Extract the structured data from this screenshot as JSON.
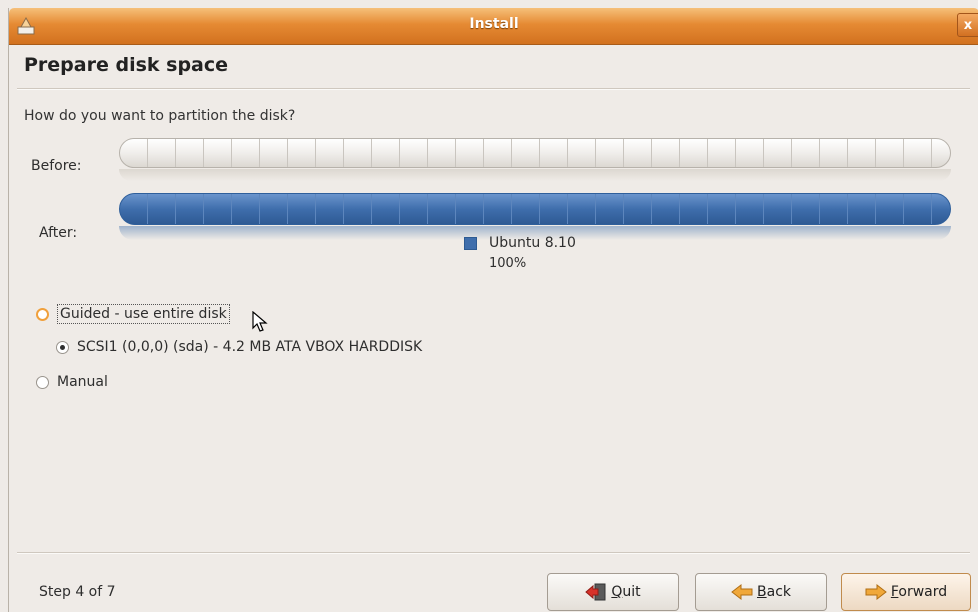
{
  "window": {
    "title": "Install",
    "close_glyph": "x",
    "accent_color": "#e58a33"
  },
  "page": {
    "title": "Prepare disk space",
    "question": "How do you want to partition the disk?"
  },
  "partition": {
    "before_label": "Before:",
    "after_label": "After:",
    "legend": {
      "name": "Ubuntu 8.10",
      "percent": "100%",
      "color": "#3f6eac"
    }
  },
  "options": [
    {
      "label": "Guided - use entire disk",
      "selected": false,
      "focused": true
    },
    {
      "label": "SCSI1 (0,0,0) (sda) - 4.2 MB ATA VBOX HARDDISK",
      "selected": true
    },
    {
      "label": "Manual",
      "selected": false
    }
  ],
  "footer": {
    "step": "Step 4 of 7",
    "quit": {
      "mnemonic": "Q",
      "rest": "uit",
      "icon": "quit-icon"
    },
    "back": {
      "mnemonic": "B",
      "rest": "ack",
      "icon": "back-arrow-icon"
    },
    "forward": {
      "mnemonic": "F",
      "rest": "orward",
      "icon": "forward-arrow-icon"
    }
  }
}
